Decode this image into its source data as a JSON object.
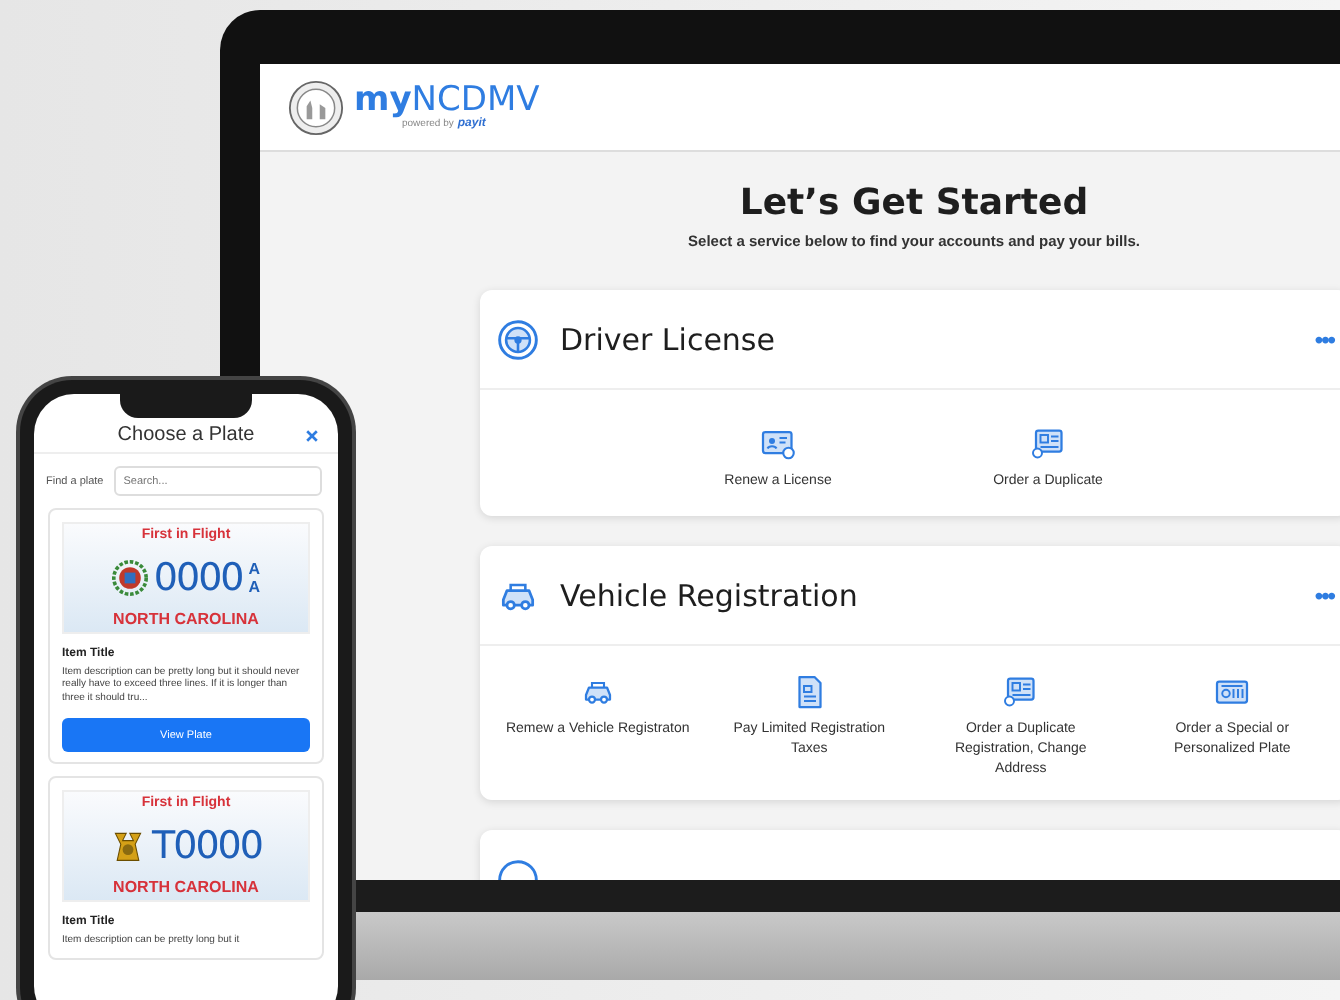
{
  "laptop": {
    "header": {
      "brand": "**my**NCDMV",
      "powered_by": "powered by",
      "partner": "payit"
    },
    "intro": {
      "title": "Let’s Get Started",
      "subtitle": "Select a service below to find your accounts and pay your bills."
    },
    "sections": [
      {
        "kind": "license",
        "title": "Driver License",
        "more": "•••",
        "actions": [
          {
            "kind": "renew",
            "label": "Renew a License"
          },
          {
            "kind": "duplicate",
            "label": "Order a Duplicate"
          }
        ]
      },
      {
        "kind": "vehicle",
        "title": "Vehicle Registration",
        "more": "•••",
        "actions": [
          {
            "kind": "vehicle",
            "label": "Remew a Vehicle Registraton"
          },
          {
            "kind": "taxes",
            "label": "Pay  Limited Registration Taxes"
          },
          {
            "kind": "duplicate",
            "label": "Order a Duplicate Registration, Change Address"
          },
          {
            "kind": "plate",
            "label": "Order a Special or Personalized Plate"
          }
        ]
      },
      {
        "kind": "partial"
      }
    ]
  },
  "phone": {
    "title": "Choose a Plate",
    "search": {
      "label": "Find a plate",
      "placeholder": "Search..."
    },
    "items": [
      {
        "plate": {
          "kind": "wreath",
          "slogan": "First in Flight",
          "number": "0000",
          "suffix": [
            "A",
            "A"
          ],
          "state": "NORTH CAROLINA"
        },
        "title": "Item Title",
        "description": "Item description can be pretty long but it should never really have to exceed three lines. If it is longer than three it should tru...",
        "button": "View Plate"
      },
      {
        "plate": {
          "kind": "mascot",
          "slogan": "First in Flight",
          "number": "T0000",
          "state": "NORTH CAROLINA"
        },
        "title": "Item Title",
        "description": "Item description can be pretty long but it"
      }
    ]
  }
}
